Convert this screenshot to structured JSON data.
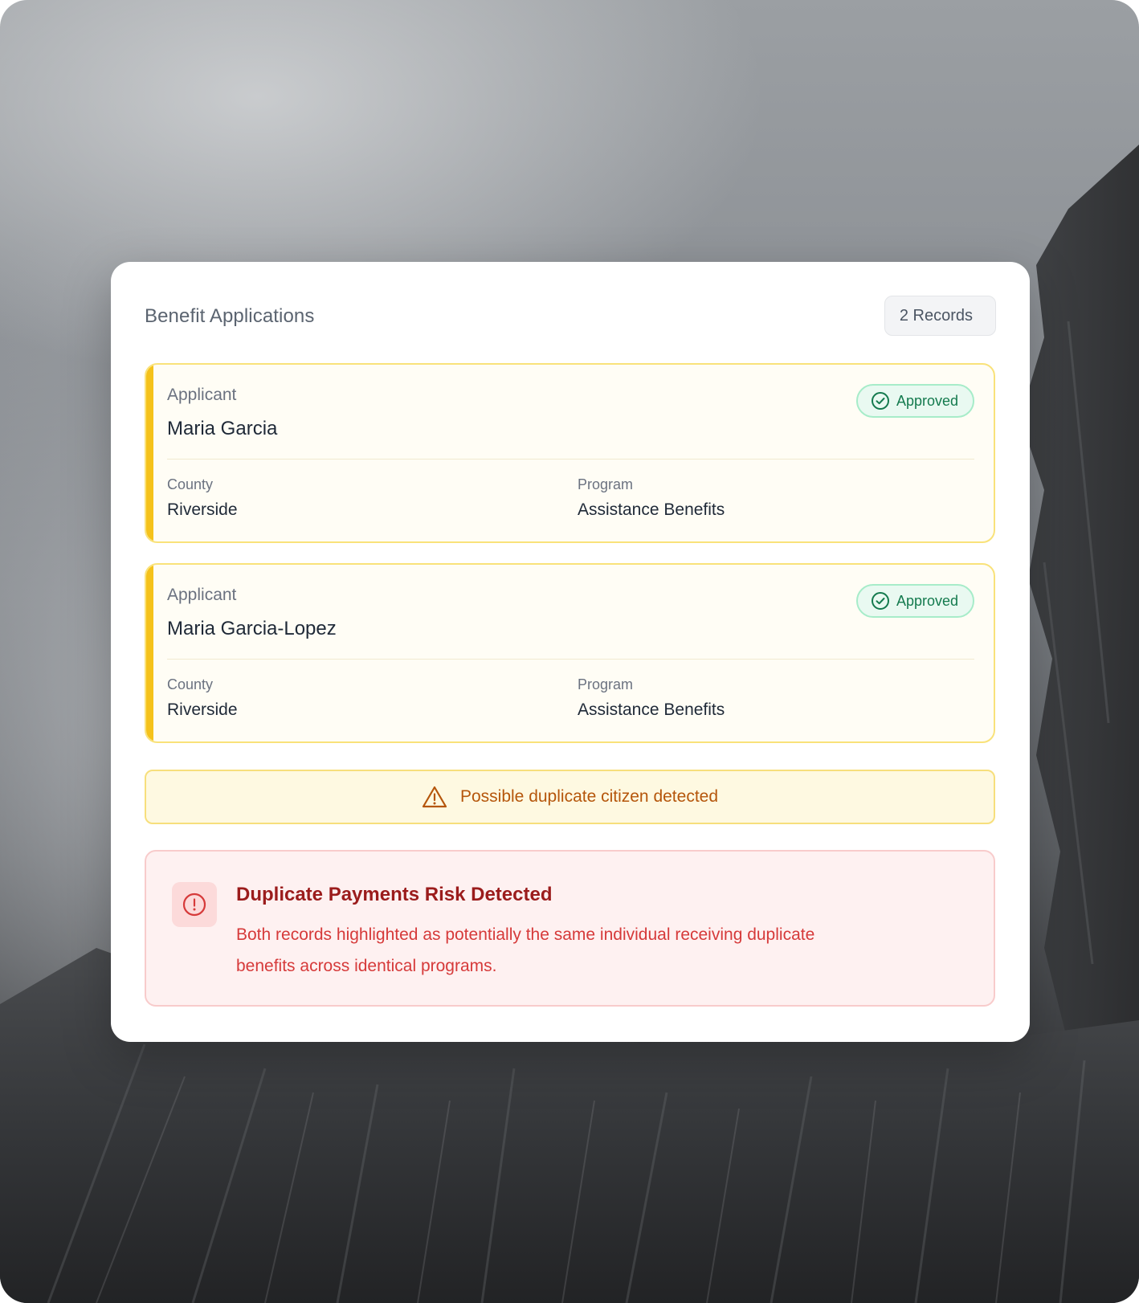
{
  "panel": {
    "title": "Benefit Applications",
    "records_count": "2 Records"
  },
  "records": [
    {
      "applicant_label": "Applicant",
      "applicant_name": "Maria Garcia",
      "status": "Approved",
      "county_label": "County",
      "county": "Riverside",
      "program_label": "Program",
      "program": "Assistance Benefits"
    },
    {
      "applicant_label": "Applicant",
      "applicant_name": "Maria Garcia-Lopez",
      "status": "Approved",
      "county_label": "County",
      "county": "Riverside",
      "program_label": "Program",
      "program": "Assistance Benefits"
    }
  ],
  "warning": {
    "icon": "warning-triangle-icon",
    "text": "Possible duplicate citizen detected"
  },
  "alert": {
    "icon": "alert-circle-icon",
    "title": "Duplicate Payments Risk Detected",
    "message": "Both records highlighted as potentially the same individual receiving duplicate benefits across identical programs."
  },
  "colors": {
    "accent_yellow": "#f5c21b",
    "approved_green": "#147a4e",
    "warning_orange": "#b5560b",
    "danger_red": "#9b1c1c"
  }
}
